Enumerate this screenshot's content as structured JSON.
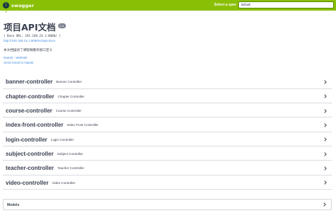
{
  "topbar": {
    "logo_icon": "{ }",
    "logo_text": "swagger",
    "spec_label": "Select a spec",
    "spec_selected": "default"
  },
  "info": {
    "title": "项目API文档",
    "version": "1.0",
    "base_url": "[ Base URL: 192.168.24.1:8080/ ]",
    "api_docs_link": "http://192.168.24.1:8080/v2/api-docs",
    "description": "本文档描述了课程微服务接口定义",
    "contact_website": "Natuki - Website",
    "contact_email": "Send email to Natuki"
  },
  "controllers": [
    {
      "name": "banner-controller",
      "description": "Banner Controller"
    },
    {
      "name": "chapter-controller",
      "description": "Chapter Controller"
    },
    {
      "name": "course-controller",
      "description": "Course Controller"
    },
    {
      "name": "index-front-controller",
      "description": "Index Front Controller"
    },
    {
      "name": "login-controller",
      "description": "Login Controller"
    },
    {
      "name": "subject-controller",
      "description": "Subject Controller"
    },
    {
      "name": "teacher-controller",
      "description": "Teacher Controller"
    },
    {
      "name": "video-controller",
      "description": "Video Controller"
    }
  ],
  "models": {
    "label": "Models"
  },
  "colors": {
    "topbar_bg": "#89bf04",
    "link": "#4990e2",
    "text": "#3b4151"
  },
  "icons": {
    "expand": "chevron-right-icon",
    "logo": "swagger-logo-icon"
  }
}
